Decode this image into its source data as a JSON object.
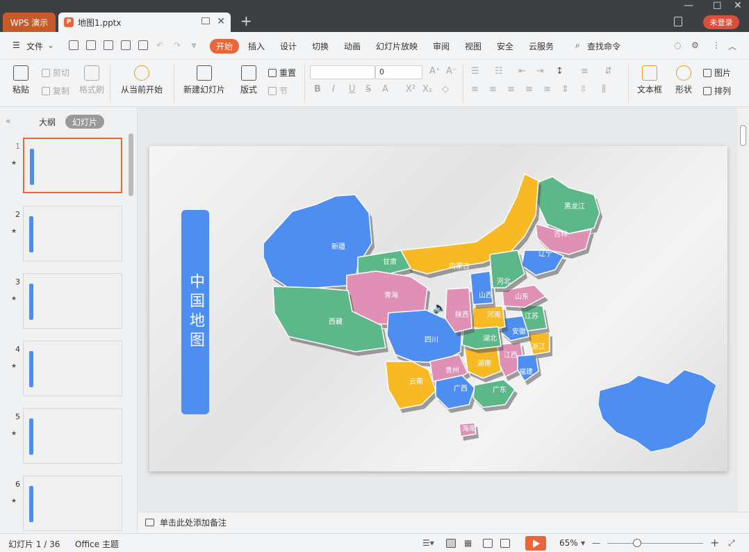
{
  "titlebar": {
    "app_tab": "WPS 演示",
    "doc_tab": "地图1.pptx",
    "new_tab": "+",
    "login": "未登录"
  },
  "menu": {
    "file": "文件",
    "items": [
      "开始",
      "插入",
      "设计",
      "切换",
      "动画",
      "幻灯片放映",
      "审阅",
      "视图",
      "安全",
      "云服务"
    ],
    "search": "查找命令"
  },
  "ribbon": {
    "paste": "粘贴",
    "cut": "剪切",
    "copy": "复制",
    "format_painter": "格式刷",
    "from_current": "从当前开始",
    "new_slide": "新建幻灯片",
    "layout": "版式",
    "reset": "重置",
    "section": "节",
    "font_size": "0",
    "textbox": "文本框",
    "shape": "形状",
    "picture": "图片",
    "arrange": "排列"
  },
  "panel": {
    "outline_tab": "大纲",
    "slides_tab": "幻灯片",
    "thumbnails": [
      "1",
      "2",
      "3",
      "4",
      "5",
      "6"
    ]
  },
  "slide": {
    "title": "中国地图",
    "provinces": [
      {
        "name": "黑龙江",
        "color": "#5cb888"
      },
      {
        "name": "吉林",
        "color": "#e08fb5"
      },
      {
        "name": "辽宁",
        "color": "#4d8ef0"
      },
      {
        "name": "内蒙古",
        "color": "#f7b924"
      },
      {
        "name": "新疆",
        "color": "#4d8ef0"
      },
      {
        "name": "甘肃",
        "color": "#5cb888"
      },
      {
        "name": "青海",
        "color": "#e08fb5"
      },
      {
        "name": "西藏",
        "color": "#5cb888"
      },
      {
        "name": "四川",
        "color": "#4d8ef0"
      },
      {
        "name": "云南",
        "color": "#f7b924"
      },
      {
        "name": "贵州",
        "color": "#e08fb5"
      },
      {
        "name": "广西",
        "color": "#4d8ef0"
      },
      {
        "name": "广东",
        "color": "#5cb888"
      },
      {
        "name": "湖南",
        "color": "#f7b924"
      },
      {
        "name": "江西",
        "color": "#e08fb5"
      },
      {
        "name": "福建",
        "color": "#4d8ef0"
      },
      {
        "name": "浙江",
        "color": "#f7b924"
      },
      {
        "name": "安徽",
        "color": "#4d8ef0"
      },
      {
        "name": "江苏",
        "color": "#5cb888"
      },
      {
        "name": "山东",
        "color": "#e08fb5"
      },
      {
        "name": "河南",
        "color": "#f7b924"
      },
      {
        "name": "湖北",
        "color": "#5cb888"
      },
      {
        "name": "陕西",
        "color": "#e08fb5"
      },
      {
        "name": "山西",
        "color": "#4d8ef0"
      },
      {
        "name": "河北",
        "color": "#5cb888"
      },
      {
        "name": "海南",
        "color": "#e08fb5"
      }
    ]
  },
  "notes": {
    "placeholder": "单击此处添加备注"
  },
  "status": {
    "slide_count": "幻灯片 1 / 36",
    "theme": "Office 主题",
    "zoom": "65%"
  },
  "colors": {
    "accent": "#e8663a",
    "blue": "#4d8ef0",
    "green": "#5cb888",
    "yellow": "#f7b924",
    "pink": "#e08fb5"
  }
}
